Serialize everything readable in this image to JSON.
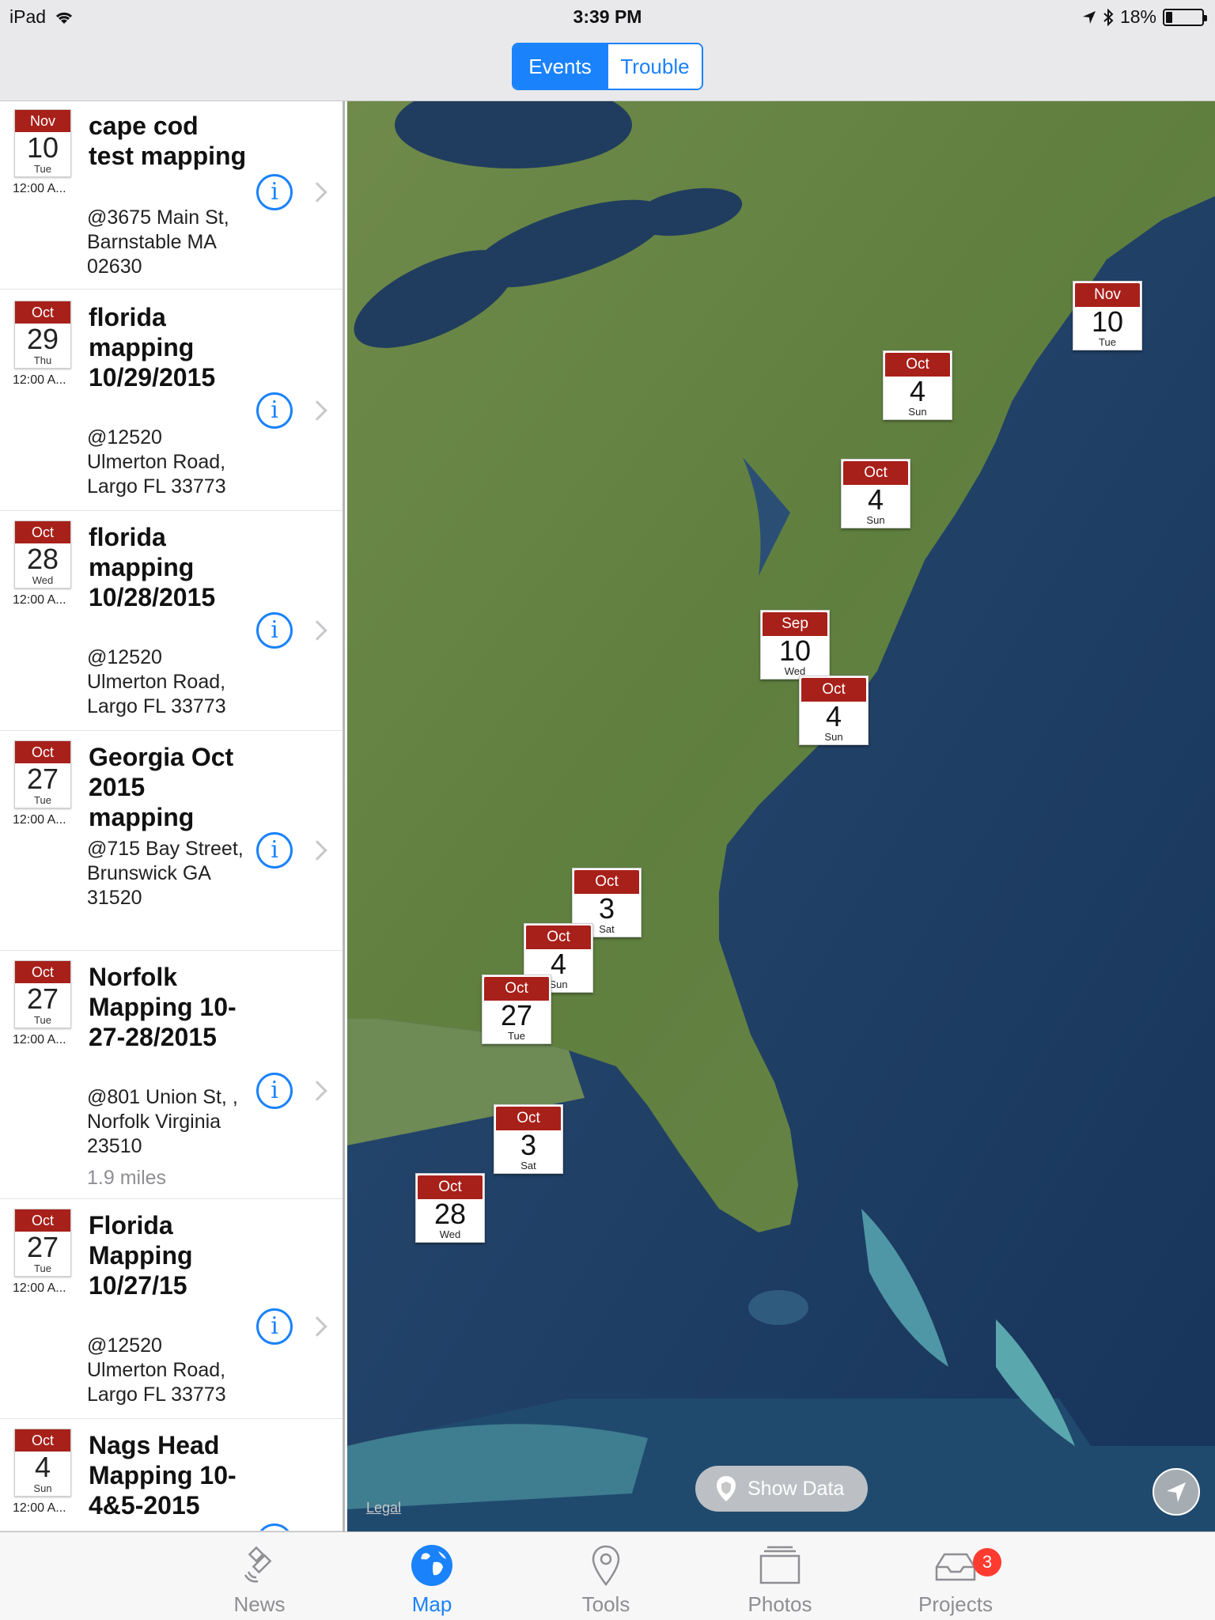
{
  "status_bar": {
    "device": "iPad",
    "time": "3:39 PM",
    "battery": "18%"
  },
  "nav": {
    "segments": [
      "Events",
      "Trouble"
    ],
    "selected": "Events"
  },
  "events": [
    {
      "month": "Nov",
      "day": "10",
      "weekday": "Tue",
      "time": "12:00 A...",
      "title": "cape cod test mapping",
      "address": "@3675 Main St, Barnstable MA 02630",
      "distance": ""
    },
    {
      "month": "Oct",
      "day": "29",
      "weekday": "Thu",
      "time": "12:00 A...",
      "title": "florida mapping 10/29/2015",
      "address": "@12520 Ulmerton Road, Largo FL 33773",
      "distance": ""
    },
    {
      "month": "Oct",
      "day": "28",
      "weekday": "Wed",
      "time": "12:00 A...",
      "title": "florida mapping 10/28/2015",
      "address": "@12520 Ulmerton Road, Largo FL 33773",
      "distance": ""
    },
    {
      "month": "Oct",
      "day": "27",
      "weekday": "Tue",
      "time": "12:00 A...",
      "title": "Georgia Oct 2015 mapping",
      "address": "@715 Bay Street, Brunswick GA 31520",
      "distance": ""
    },
    {
      "month": "Oct",
      "day": "27",
      "weekday": "Tue",
      "time": "12:00 A...",
      "title": "Norfolk Mapping 10-27-28/2015",
      "address": "@801 Union St, , Norfolk Virginia 23510",
      "distance": "1.9 miles"
    },
    {
      "month": "Oct",
      "day": "27",
      "weekday": "Tue",
      "time": "12:00 A...",
      "title": "Florida Mapping 10/27/15",
      "address": "@12520 Ulmerton Road, Largo FL 33773",
      "distance": ""
    },
    {
      "month": "Oct",
      "day": "4",
      "weekday": "Sun",
      "time": "12:00 A...",
      "title": "Nags Head Mapping 10-4&5-2015",
      "address": "",
      "distance": ""
    }
  ],
  "map": {
    "legal": "Legal",
    "show_data": "Show Data",
    "pins": [
      {
        "month": "Nov",
        "day": "10",
        "weekday": "Tue"
      },
      {
        "month": "Oct",
        "day": "4",
        "weekday": "Sun"
      },
      {
        "month": "Oct",
        "day": "4",
        "weekday": "Sun"
      },
      {
        "month": "Sep",
        "day": "10",
        "weekday": "Wed"
      },
      {
        "month": "Oct",
        "day": "4",
        "weekday": "Sun"
      },
      {
        "month": "Oct",
        "day": "3",
        "weekday": "Sat"
      },
      {
        "month": "Oct",
        "day": "4",
        "weekday": "Sun"
      },
      {
        "month": "Oct",
        "day": "27",
        "weekday": "Tue"
      },
      {
        "month": "Oct",
        "day": "3",
        "weekday": "Sat"
      },
      {
        "month": "Oct",
        "day": "28",
        "weekday": "Wed"
      }
    ]
  },
  "tabs": [
    {
      "label": "News",
      "icon": "satellite-icon"
    },
    {
      "label": "Map",
      "icon": "globe-icon"
    },
    {
      "label": "Tools",
      "icon": "location-pin-icon"
    },
    {
      "label": "Photos",
      "icon": "photos-stack-icon"
    },
    {
      "label": "Projects",
      "icon": "inbox-tray-icon",
      "badge": "3"
    }
  ],
  "active_tab": "Map",
  "colors": {
    "accent": "#1a82fb",
    "calendar_red": "#a8201a",
    "badge": "#ff3b30"
  }
}
